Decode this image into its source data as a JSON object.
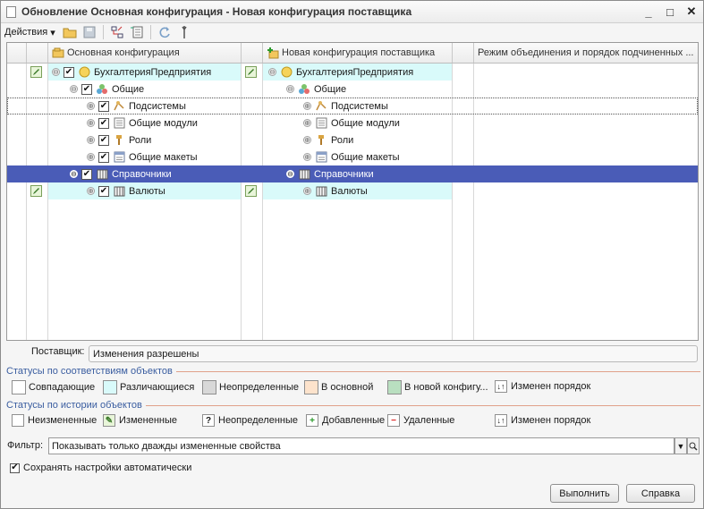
{
  "window": {
    "title": "Обновление Основная конфигурация - Новая конфигурация поставщика",
    "minimize_glyph": "_",
    "maximize_glyph": "□",
    "close_glyph": "✕"
  },
  "toolbar": {
    "actions_label": "Действия",
    "actions_arrow": "▾"
  },
  "grid": {
    "headers": {
      "main": "Основная конфигурация",
      "vendor": "Новая конфигурация поставщика",
      "mode": "Режим объединения и порядок подчиненных ..."
    },
    "rows": [
      {
        "name": "БухгалтерияПредприятия",
        "expander": "⊖",
        "checked": true,
        "icon": "config-root-icon",
        "pencil": true
      },
      {
        "name": "Общие",
        "expander": "⊖",
        "checked": true,
        "icon": "common-group-icon",
        "pencil": false
      },
      {
        "name": "Подсистемы",
        "expander": "⊕",
        "checked": true,
        "icon": "subsystems-icon",
        "pencil": false
      },
      {
        "name": "Общие модули",
        "expander": "⊕",
        "checked": true,
        "icon": "common-modules-icon",
        "pencil": false
      },
      {
        "name": "Роли",
        "expander": "⊕",
        "checked": true,
        "icon": "roles-icon",
        "pencil": false
      },
      {
        "name": "Общие макеты",
        "expander": "⊕",
        "checked": true,
        "icon": "common-templates-icon",
        "pencil": false
      },
      {
        "name": "Справочники",
        "expander": "⊖",
        "checked": true,
        "icon": "catalogs-icon",
        "pencil": false
      },
      {
        "name": "Валюты",
        "expander": "⊕",
        "checked": true,
        "icon": "catalog-icon",
        "pencil": true
      }
    ]
  },
  "supplier": {
    "label": "Поставщик:",
    "value": "Изменения разрешены"
  },
  "match_statuses": {
    "title": "Статусы по соответствиям объектов",
    "items": [
      {
        "label": "Совпадающие",
        "color": "#ffffff"
      },
      {
        "label": "Различающиеся",
        "color": "#d9fafa"
      },
      {
        "label": "Неопределенные",
        "color": "#d8d8d8"
      },
      {
        "label": "В основной",
        "color": "#fde3cc"
      },
      {
        "label": "В новой конфигу...",
        "color": "#b9dfc0"
      },
      {
        "label": "Изменен порядок",
        "color": "#ffffff"
      }
    ]
  },
  "history_statuses": {
    "title": "Статусы по истории объектов",
    "items": [
      {
        "label": "Неизмененные",
        "glyph": ""
      },
      {
        "label": "Измененные",
        "glyph": "✎"
      },
      {
        "label": "Неопределенные",
        "glyph": "?"
      },
      {
        "label": "Добавленные",
        "glyph": "+"
      },
      {
        "label": "Удаленные",
        "glyph": "−"
      },
      {
        "label": "Изменен порядок",
        "glyph": "↓↑"
      }
    ]
  },
  "filter": {
    "label": "Фильтр:",
    "value": "Показывать только дважды измененные свойства"
  },
  "save_settings": {
    "label": "Сохранять настройки автоматически",
    "checked": true
  },
  "buttons": {
    "execute": "Выполнить",
    "help": "Справка"
  },
  "colors": {
    "selected_row": "#4a5cb7",
    "different_row": "#d9fafa",
    "section_title": "#3a5da0"
  }
}
